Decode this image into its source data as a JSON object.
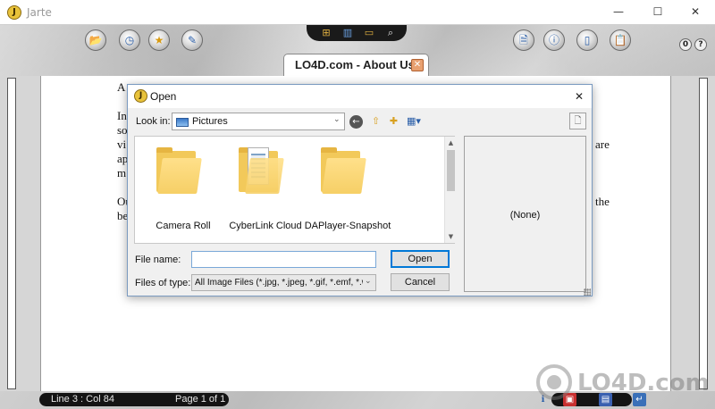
{
  "window": {
    "title": "Jarte",
    "logo_letter": "J",
    "minimize_glyph": "—",
    "maximize_glyph": "☐",
    "close_glyph": "✕"
  },
  "toolbar": {
    "left_buttons": [
      "open-folder-icon",
      "history-clock-icon",
      "favorites-star-icon",
      "edit-document-icon"
    ],
    "center_icons": [
      "insert-icon",
      "chart-icon",
      "folder-icon",
      "find-icon"
    ],
    "right_buttons": [
      "new-document-icon",
      "document-info-icon",
      "page-icon",
      "clipboard-icon"
    ],
    "mini_buttons": [
      "0",
      "?"
    ]
  },
  "tab": {
    "label": "LO4D.com - About Us",
    "close_glyph": "✕"
  },
  "document": {
    "lines": [
      "A",
      "In",
      "so",
      "vi",
      "ap",
      "m",
      "Ou",
      "be"
    ],
    "right_fragments": [
      "are",
      "the"
    ]
  },
  "status": {
    "position": "Line 3 : Col 84",
    "page": "Page 1 of 1"
  },
  "watermark": {
    "text": "LO4D.com"
  },
  "dialog": {
    "title": "Open",
    "logo_letter": "J",
    "close_glyph": "✕",
    "look_in_label": "Look in:",
    "look_in_value": "Pictures",
    "folders": [
      {
        "name": "Camera Roll",
        "icon": "folder-icon"
      },
      {
        "name": "CyberLink Cloud",
        "icon": "folder-with-files-icon"
      },
      {
        "name": "DAPlayer-Snapshot",
        "icon": "folder-icon"
      }
    ],
    "preview_text": "(None)",
    "file_name_label": "File name:",
    "file_name_value": "",
    "files_of_type_label": "Files of type:",
    "files_of_type_value": "All Image Files (*.jpg, *.jpeg, *.gif, *.emf, *.wm",
    "open_button": "Open",
    "cancel_button": "Cancel"
  },
  "colors": {
    "accent": "#0078d7",
    "folder_yellow": "#f2c95a",
    "status_bar_pill": "#141414",
    "tab_close": "#e8a070"
  }
}
